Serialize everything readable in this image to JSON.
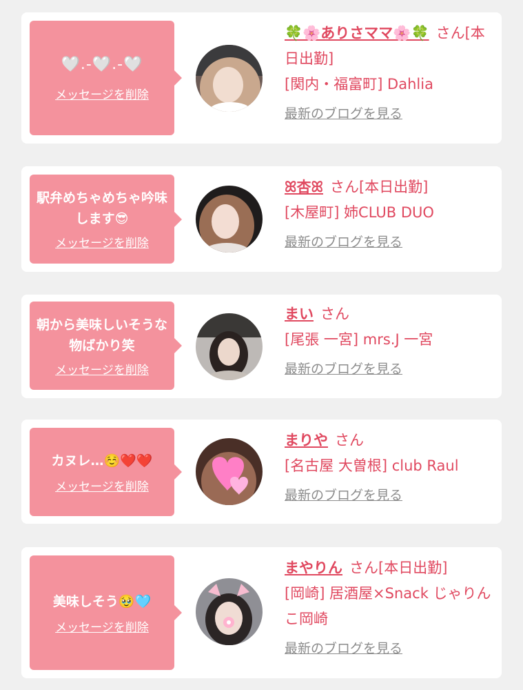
{
  "messages": [
    {
      "bubble_text": "🤍.-🤍.-🤍",
      "delete_label": "メッセージを削除",
      "name": "🍀🌸ありさママ🌸🍀",
      "honorific": "さん",
      "status": "[本日出勤]",
      "location": "[関内・福富町] Dahlia",
      "blog_label": "最新のブログを見る"
    },
    {
      "bubble_text": "駅弁めちゃめちゃ吟味します😎",
      "delete_label": "メッセージを削除",
      "name": "ꕤ杏ꕤ",
      "honorific": "さん",
      "status": "[本日出勤]",
      "location": "[木屋町] 姉CLUB DUO",
      "blog_label": "最新のブログを見る"
    },
    {
      "bubble_text": "朝から美味しいそうな物ばかり笑",
      "delete_label": "メッセージを削除",
      "name": "まい",
      "honorific": "さん",
      "status": "",
      "location": "[尾張 一宮] mrs.J 一宮",
      "blog_label": "最新のブログを見る"
    },
    {
      "bubble_text": "カヌレ…☺️❤️❤️",
      "delete_label": "メッセージを削除",
      "name": "まりや",
      "honorific": "さん",
      "status": "",
      "location": "[名古屋 大曽根] club Raul",
      "blog_label": "最新のブログを見る"
    },
    {
      "bubble_text": "美味しそう🥹🩵",
      "delete_label": "メッセージを削除",
      "name": "まやりん",
      "honorific": "さん",
      "status": "[本日出勤]",
      "location": "[岡崎] 居酒屋×Snack じゃりんこ岡崎",
      "blog_label": "最新のブログを見る"
    }
  ]
}
